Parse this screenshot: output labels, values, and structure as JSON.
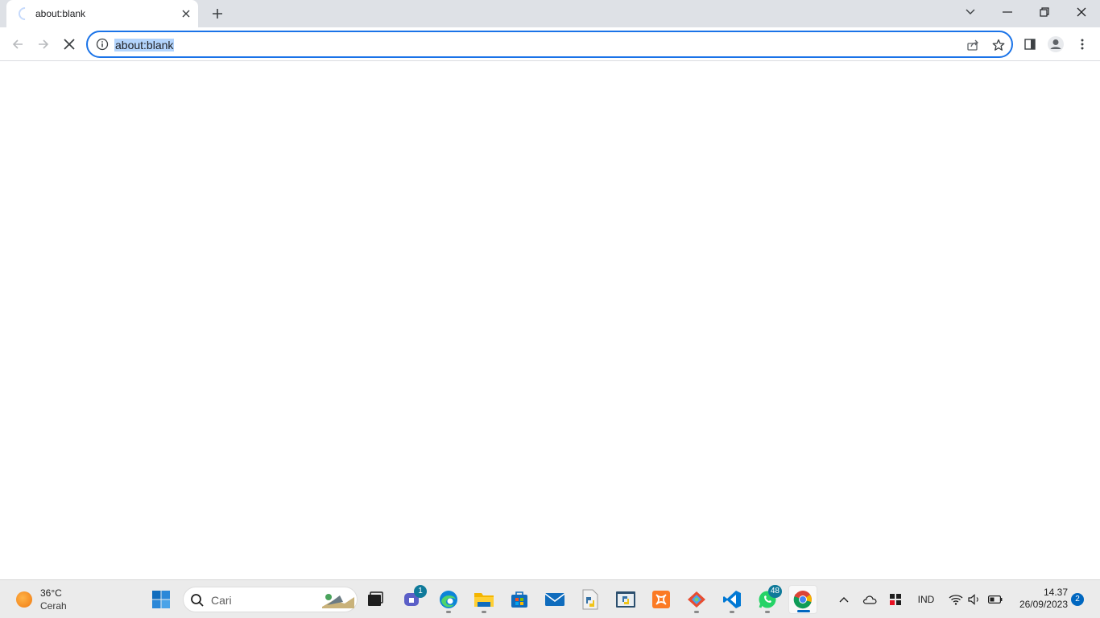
{
  "browser": {
    "tab_title": "about:blank",
    "url": "about:blank"
  },
  "weather": {
    "temp": "36°C",
    "condition": "Cerah"
  },
  "taskbar": {
    "search_placeholder": "Cari",
    "teams_badge": "1",
    "whatsapp_badge": "48"
  },
  "tray": {
    "language": "IND"
  },
  "clock": {
    "time": "14.37",
    "date": "26/09/2023",
    "notifications": "2"
  },
  "colors": {
    "accent": "#1a73e8",
    "taskbar_accent": "#0067c0"
  }
}
